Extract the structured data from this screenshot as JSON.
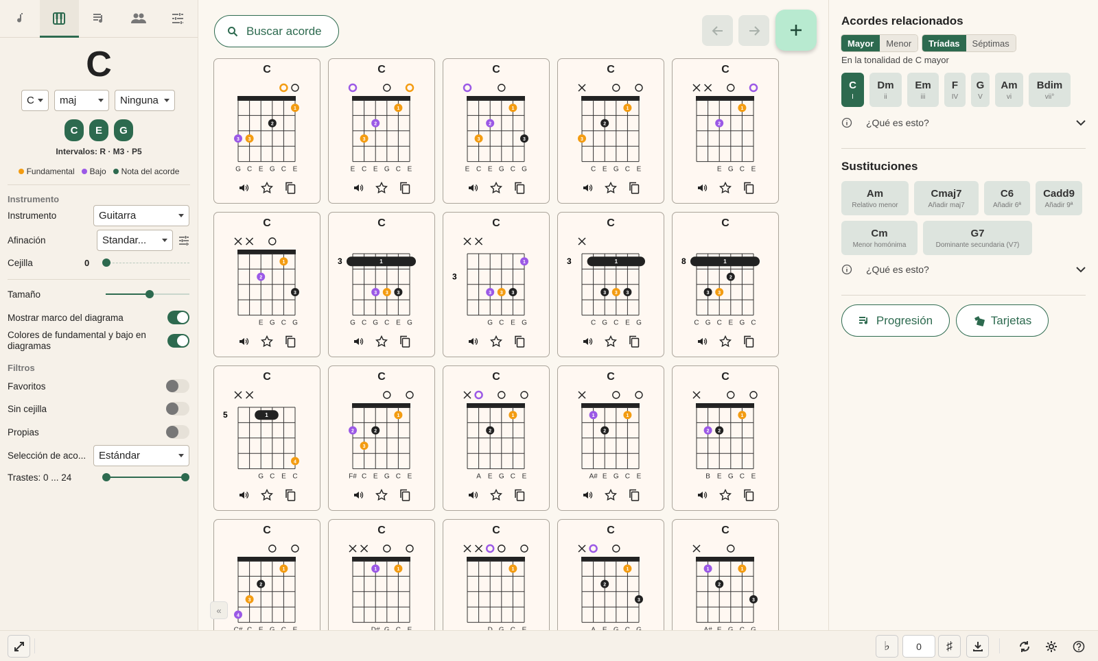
{
  "tabs": [
    {
      "icon": "music-note-icon"
    },
    {
      "icon": "piano-icon"
    },
    {
      "icon": "playlist-icon"
    },
    {
      "icon": "people-icon"
    },
    {
      "icon": "tune-icon"
    }
  ],
  "chord": {
    "title": "C",
    "root": "C",
    "quality": "maj",
    "bass": "Ninguna",
    "notes": [
      "C",
      "E",
      "G"
    ],
    "intervals": "Intervalos: R · M3 · P5"
  },
  "legend": {
    "root": "Fundamental",
    "bass": "Bajo",
    "tone": "Nota del acorde"
  },
  "colors": {
    "accent": "#2d6a4f",
    "root": "#f39c12",
    "bass": "#9b59e6",
    "tone": "#222222"
  },
  "settings": {
    "instrument_section": "Instrumento",
    "instrument_label": "Instrumento",
    "instrument_value": "Guitarra",
    "tuning_label": "Afinación",
    "tuning_value": "Standar...",
    "capo_label": "Cejilla",
    "capo_value": "0",
    "size_label": "Tamaño",
    "size_fraction": 0.55,
    "frame_label": "Mostrar marco del diagrama",
    "frame_on": true,
    "colors_label": "Colores de fundamental y bajo en diagramas",
    "colors_on": true,
    "filters_section": "Filtros",
    "favorites_label": "Favoritos",
    "favorites_on": false,
    "nobarre_label": "Sin cejilla",
    "nobarre_on": false,
    "own_label": "Propias",
    "own_on": false,
    "selection_label": "Selección de aco...",
    "selection_value": "Estándar",
    "frets_label": "Trastes: 0 ... 24"
  },
  "main": {
    "search_label": "Buscar acorde"
  },
  "diagrams": [
    {
      "title": "C",
      "strings": [
        "",
        "",
        "",
        "",
        "R*",
        "O"
      ],
      "dots": [
        [
          5,
          1,
          "R"
        ],
        [
          3,
          2,
          "T"
        ],
        [
          0,
          3,
          "B"
        ],
        [
          1,
          3,
          "R"
        ]
      ],
      "notes": [
        "G",
        "C",
        "E",
        "G",
        "C",
        "E"
      ]
    },
    {
      "title": "C",
      "strings": [
        "B*",
        "",
        "",
        "O",
        "",
        "R*"
      ],
      "dots": [
        [
          4,
          1,
          "R"
        ],
        [
          2,
          2,
          "B"
        ],
        [
          1,
          3,
          "R"
        ]
      ],
      "notes": [
        "E",
        "C",
        "E",
        "G",
        "C",
        "E"
      ]
    },
    {
      "title": "C",
      "strings": [
        "B*",
        "",
        "",
        "O",
        "",
        ""
      ],
      "dots": [
        [
          4,
          1,
          "R"
        ],
        [
          2,
          2,
          "B"
        ],
        [
          1,
          3,
          "R"
        ],
        [
          5,
          3,
          "T"
        ]
      ],
      "notes": [
        "E",
        "C",
        "E",
        "G",
        "C",
        "G"
      ]
    },
    {
      "title": "C",
      "strings": [
        "X",
        "",
        "",
        "O",
        "",
        "O"
      ],
      "dots": [
        [
          4,
          1,
          "R"
        ],
        [
          2,
          2,
          "T"
        ],
        [
          0,
          3,
          "R"
        ]
      ],
      "notes": [
        "",
        "C",
        "E",
        "G",
        "C",
        "E"
      ]
    },
    {
      "title": "C",
      "strings": [
        "X",
        "X",
        "",
        "O",
        "",
        "B*"
      ],
      "dots": [
        [
          4,
          1,
          "R"
        ],
        [
          2,
          2,
          "B"
        ]
      ],
      "notes": [
        "",
        "",
        "E",
        "G",
        "C",
        "E"
      ]
    },
    {
      "title": "C",
      "strings": [
        "X",
        "X",
        "",
        "O",
        "",
        ""
      ],
      "dots": [
        [
          4,
          1,
          "R"
        ],
        [
          2,
          2,
          "B"
        ],
        [
          5,
          3,
          "T"
        ]
      ],
      "notes": [
        "",
        "",
        "E",
        "G",
        "C",
        "G"
      ]
    },
    {
      "title": "C",
      "fret": "3",
      "barre": [
        0,
        5
      ],
      "strings": [
        "",
        "",
        "",
        "",
        "",
        ""
      ],
      "dots": [
        [
          2,
          3,
          "B"
        ],
        [
          3,
          3,
          "R"
        ],
        [
          4,
          3,
          "T"
        ]
      ],
      "notes": [
        "G",
        "C",
        "G",
        "C",
        "E",
        "G"
      ]
    },
    {
      "title": "C",
      "fret": "3",
      "strings": [
        "X",
        "X",
        "",
        "",
        "",
        ""
      ],
      "dots": [
        [
          5,
          1,
          "B"
        ],
        [
          2,
          3,
          "B"
        ],
        [
          3,
          3,
          "R"
        ],
        [
          4,
          3,
          "T"
        ]
      ],
      "notes": [
        "",
        "",
        "G",
        "C",
        "E",
        "G"
      ]
    },
    {
      "title": "C",
      "fret": "3",
      "barre": [
        1,
        5
      ],
      "strings": [
        "X",
        "",
        "",
        "",
        "",
        ""
      ],
      "dots": [
        [
          2,
          3,
          "T"
        ],
        [
          3,
          3,
          "R"
        ],
        [
          4,
          3,
          "T"
        ]
      ],
      "notes": [
        "",
        "C",
        "G",
        "C",
        "E",
        "G"
      ]
    },
    {
      "title": "C",
      "fret": "8",
      "barre": [
        0,
        5
      ],
      "strings": [
        "",
        "",
        "",
        "",
        "",
        ""
      ],
      "dots": [
        [
          3,
          2,
          "T"
        ],
        [
          1,
          3,
          "T"
        ],
        [
          2,
          3,
          "R"
        ]
      ],
      "notes": [
        "C",
        "G",
        "C",
        "E",
        "G",
        "C"
      ]
    },
    {
      "title": "C",
      "fret": "5",
      "barre": [
        2,
        3
      ],
      "strings": [
        "X",
        "X",
        "",
        "",
        "",
        ""
      ],
      "dots": [
        [
          5,
          4,
          "R"
        ]
      ],
      "notes": [
        "",
        "",
        "G",
        "C",
        "E",
        "C"
      ]
    },
    {
      "title": "C",
      "strings": [
        "",
        "",
        "",
        "O",
        "",
        "O"
      ],
      "dots": [
        [
          4,
          1,
          "R"
        ],
        [
          0,
          2,
          "B"
        ],
        [
          2,
          2,
          "T"
        ],
        [
          1,
          3,
          "R"
        ]
      ],
      "notes": [
        "F#",
        "C",
        "E",
        "G",
        "C",
        "E"
      ]
    },
    {
      "title": "C",
      "strings": [
        "X",
        "B*",
        "",
        "O",
        "",
        "O"
      ],
      "dots": [
        [
          4,
          1,
          "R"
        ],
        [
          2,
          2,
          "T"
        ]
      ],
      "notes": [
        "",
        "A",
        "E",
        "G",
        "C",
        "E"
      ]
    },
    {
      "title": "C",
      "strings": [
        "X",
        "",
        "",
        "O",
        "",
        "O"
      ],
      "dots": [
        [
          1,
          1,
          "B"
        ],
        [
          4,
          1,
          "R"
        ],
        [
          2,
          2,
          "T"
        ]
      ],
      "notes": [
        "",
        "A#",
        "E",
        "G",
        "C",
        "E"
      ]
    },
    {
      "title": "C",
      "strings": [
        "X",
        "",
        "",
        "O",
        "",
        "O"
      ],
      "dots": [
        [
          4,
          1,
          "R"
        ],
        [
          1,
          2,
          "B"
        ],
        [
          2,
          2,
          "T"
        ]
      ],
      "notes": [
        "",
        "B",
        "E",
        "G",
        "C",
        "E"
      ]
    },
    {
      "title": "C",
      "strings": [
        "",
        "",
        "",
        "O",
        "",
        "O"
      ],
      "dots": [
        [
          4,
          1,
          "R"
        ],
        [
          2,
          2,
          "T"
        ],
        [
          1,
          3,
          "R"
        ],
        [
          0,
          4,
          "B"
        ]
      ],
      "notes": [
        "C#",
        "C",
        "E",
        "G",
        "C",
        "E"
      ]
    },
    {
      "title": "C",
      "strings": [
        "X",
        "X",
        "",
        "O",
        "",
        "O"
      ],
      "dots": [
        [
          2,
          1,
          "B"
        ],
        [
          4,
          1,
          "R"
        ]
      ],
      "notes": [
        "",
        "",
        "D#",
        "G",
        "C",
        "E"
      ]
    },
    {
      "title": "C",
      "strings": [
        "X",
        "X",
        "B*",
        "O",
        "",
        "O"
      ],
      "dots": [
        [
          4,
          1,
          "R"
        ]
      ],
      "notes": [
        "",
        "",
        "D",
        "G",
        "C",
        "E"
      ]
    },
    {
      "title": "C",
      "strings": [
        "X",
        "B*",
        "",
        "O",
        "",
        ""
      ],
      "dots": [
        [
          4,
          1,
          "R"
        ],
        [
          2,
          2,
          "T"
        ],
        [
          5,
          3,
          "T"
        ]
      ],
      "notes": [
        "",
        "A",
        "E",
        "G",
        "C",
        "G"
      ]
    },
    {
      "title": "C",
      "strings": [
        "X",
        "",
        "",
        "O",
        "",
        ""
      ],
      "dots": [
        [
          1,
          1,
          "B"
        ],
        [
          4,
          1,
          "R"
        ],
        [
          2,
          2,
          "T"
        ],
        [
          5,
          3,
          "T"
        ]
      ],
      "notes": [
        "",
        "A#",
        "E",
        "G",
        "C",
        "G"
      ]
    }
  ],
  "card_icons": [
    "speaker-icon",
    "star-icon",
    "copy-icon"
  ],
  "related": {
    "title": "Acordes relacionados",
    "mode": [
      "Mayor",
      "Menor"
    ],
    "type": [
      "Tríadas",
      "Séptimas"
    ],
    "key_text": "En la tonalidad de C mayor",
    "chords": [
      {
        "name": "C",
        "degree": "I"
      },
      {
        "name": "Dm",
        "degree": "ii"
      },
      {
        "name": "Em",
        "degree": "iii"
      },
      {
        "name": "F",
        "degree": "IV"
      },
      {
        "name": "G",
        "degree": "V"
      },
      {
        "name": "Am",
        "degree": "vi"
      },
      {
        "name": "Bdim",
        "degree": "vii°"
      }
    ],
    "help": "¿Qué es esto?"
  },
  "substitutions": {
    "title": "Sustituciones",
    "items": [
      {
        "name": "Am",
        "desc": "Relativo menor"
      },
      {
        "name": "Cmaj7",
        "desc": "Añadir maj7"
      },
      {
        "name": "C6",
        "desc": "Añadir 6ª"
      },
      {
        "name": "Cadd9",
        "desc": "Añadir 9ª"
      },
      {
        "name": "Cm",
        "desc": "Menor homónima"
      },
      {
        "name": "G7",
        "desc": "Dominante secundaria (V7)"
      }
    ],
    "help": "¿Qué es esto?"
  },
  "actions": {
    "progression": "Progresión",
    "cards": "Tarjetas"
  },
  "bottom": {
    "flat": "♭",
    "transpose": "0",
    "sharp": "♯"
  }
}
